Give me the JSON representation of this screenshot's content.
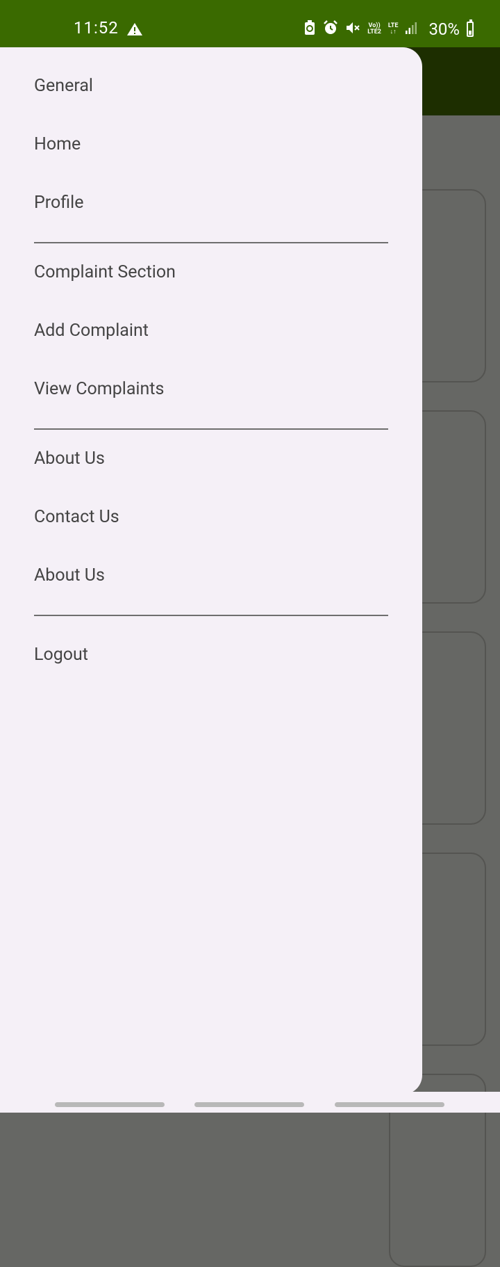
{
  "status_bar": {
    "time": "11:52",
    "volte": "Vo))",
    "lte2": "LTE2",
    "lte": "LTE",
    "battery": "30%"
  },
  "drawer": {
    "sections": [
      {
        "items": [
          "General",
          "Home",
          "Profile"
        ]
      },
      {
        "items": [
          "Complaint Section",
          "Add Complaint",
          "View Complaints"
        ]
      },
      {
        "items": [
          "About Us",
          "Contact Us",
          "About Us"
        ]
      },
      {
        "items": [
          "Logout"
        ]
      }
    ]
  },
  "colors": {
    "status_bar": "#3a6a00",
    "app_bar_dimmed": "#1d2e00",
    "drawer_bg": "#f5f0f7",
    "scrim": "#666764"
  }
}
